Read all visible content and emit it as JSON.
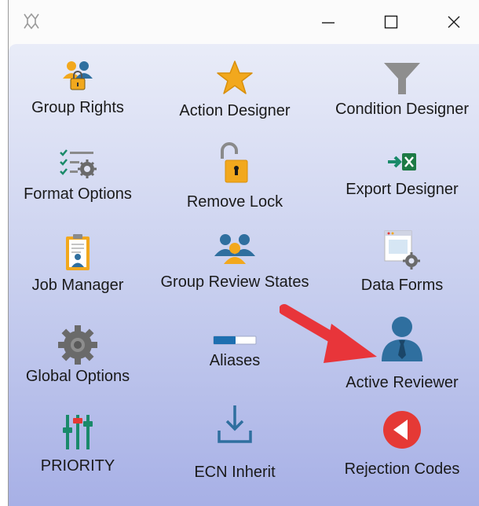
{
  "window": {
    "controls": {
      "minimize": "—",
      "maximize": "☐",
      "close": "✕"
    }
  },
  "tiles": [
    {
      "label": "Group Rights",
      "icon": "group-rights-icon"
    },
    {
      "label": "Action Designer",
      "icon": "star-icon"
    },
    {
      "label": "Condition Designer",
      "icon": "filter-funnel-icon"
    },
    {
      "label": "Format Options",
      "icon": "format-options-icon"
    },
    {
      "label": "Remove Lock",
      "icon": "unlocked-padlock-icon"
    },
    {
      "label": "Export Designer",
      "icon": "excel-export-icon"
    },
    {
      "label": "Job Manager",
      "icon": "clipboard-user-icon"
    },
    {
      "label": "Group Review States",
      "icon": "group-review-icon"
    },
    {
      "label": "Data Forms",
      "icon": "data-forms-icon"
    },
    {
      "label": "Global Options",
      "icon": "gear-icon"
    },
    {
      "label": "Aliases",
      "icon": "aliases-slider-icon"
    },
    {
      "label": "Active Reviewer",
      "icon": "reviewer-person-icon"
    },
    {
      "label": "PRIORITY",
      "icon": "priority-sliders-icon"
    },
    {
      "label": "ECN Inherit",
      "icon": "inherit-download-icon"
    },
    {
      "label": "Rejection Codes",
      "icon": "rejection-back-icon"
    }
  ],
  "colors": {
    "accent_blue": "#2f6f9f",
    "orange": "#f2a81d",
    "green": "#1a8a6a",
    "red": "#e53935",
    "arrow": "#e8353a"
  }
}
